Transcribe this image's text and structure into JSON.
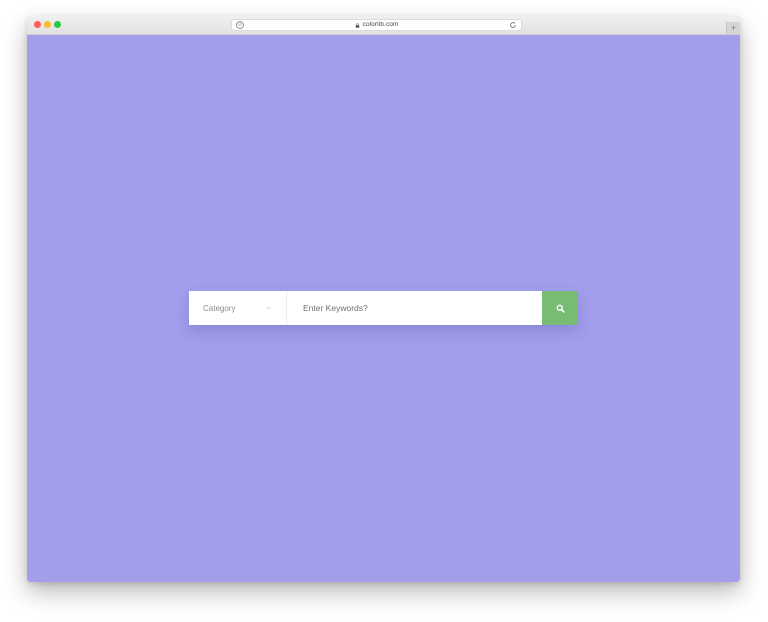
{
  "browser": {
    "url": "colorlib.com",
    "new_tab_label": "+"
  },
  "search": {
    "category_label": "Category",
    "keywords_placeholder": "Enter Keywords?",
    "keywords_value": ""
  },
  "colors": {
    "page_background": "#a29eec",
    "search_button": "#78bc73",
    "traffic_close": "#fc5f57",
    "traffic_minimize": "#fdbc2e",
    "traffic_maximize": "#28c840"
  },
  "icons": {
    "search_button": "search-icon",
    "category_dropdown": "chevron-down-icon",
    "address_lock": "lock-icon",
    "address_reload": "reload-icon",
    "address_privacy": "shield-icon"
  }
}
